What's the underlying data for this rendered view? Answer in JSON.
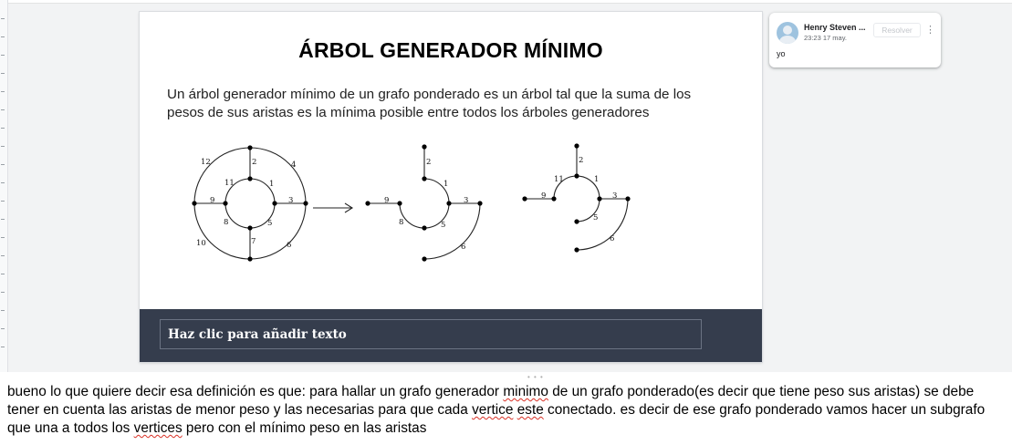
{
  "slide": {
    "title": "ÁRBOL GENERADOR MÍNIMO",
    "body": "Un árbol generador mínimo de un grafo ponderado es un árbol tal que la suma de los pesos de sus aristas es la mínima posible entre todos los árboles generadores",
    "placeholder": "Haz clic para añadir texto",
    "footer_color": "#353d4d"
  },
  "diagram": {
    "graph_weights": [
      "12",
      "2",
      "4",
      "11",
      "1",
      "9",
      "3",
      "8",
      "5",
      "10",
      "7",
      "6"
    ],
    "tree1_weights": [
      "2",
      "1",
      "9",
      "3",
      "8",
      "5",
      "6"
    ],
    "tree2_weights": [
      "2",
      "11",
      "1",
      "9",
      "3",
      "5",
      "6"
    ]
  },
  "comment": {
    "author": "Henry Steven ...",
    "time": "23:23 17 may.",
    "resolve_label": "Resolver",
    "text": "yo"
  },
  "notes": {
    "parts": [
      "bueno lo que quiere decir esa definición es que: para hallar un grafo generador ",
      "minimo",
      " de un grafo ponderado(es decir que tiene peso sus aristas) se debe tener en cuenta las aristas de menor peso y las necesarias para que cada ",
      "vertice",
      " ",
      "este",
      " conectado. es decir de ese grafo ponderado vamos hacer un subgrafo que una a todos los ",
      "vertices",
      " pero con el mínimo peso en las aristas"
    ]
  }
}
